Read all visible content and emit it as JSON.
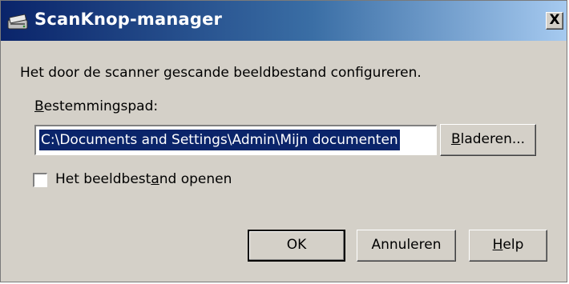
{
  "window": {
    "title": "ScanKnop-manager",
    "close_label": "X",
    "title_icon": "scanner-icon"
  },
  "dialog": {
    "description": "Het door de scanner gescande beeldbestand configureren.",
    "destination_label": "Bestemmingspad:",
    "destination_path": "C:\\Documents and Settings\\Admin\\Mijn documenten",
    "open_image_label": "Het beeldbestand openen",
    "open_image_checked": false
  },
  "buttons": {
    "browse": "Bladeren...",
    "ok": "OK",
    "cancel": "Annuleren",
    "help": "Help"
  }
}
